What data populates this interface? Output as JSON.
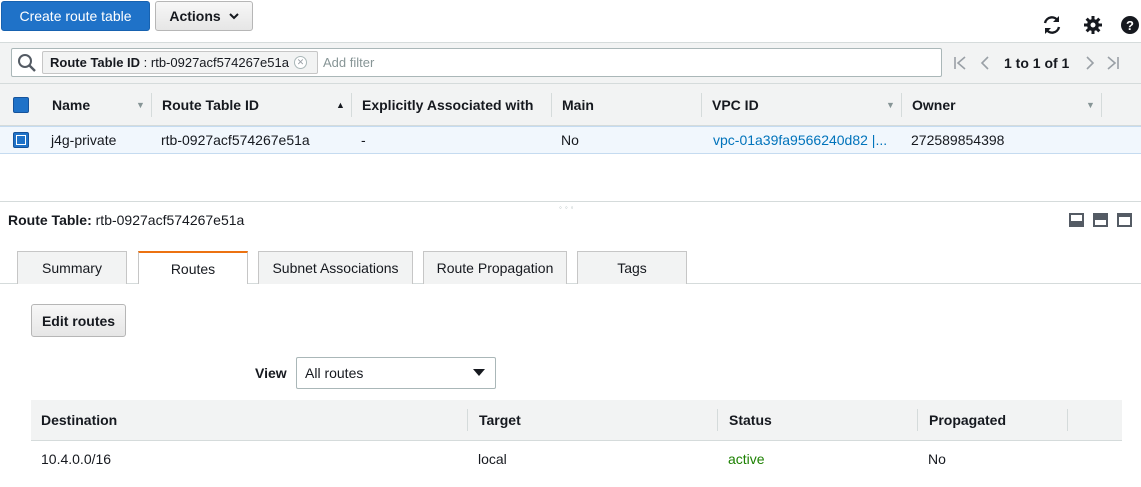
{
  "toolbar": {
    "create_label": "Create route table",
    "actions_label": "Actions",
    "icons": [
      "refresh-icon",
      "gear-icon",
      "help-icon"
    ]
  },
  "filter": {
    "token_key": "Route Table ID",
    "token_separator": " : ",
    "token_value": "rtb-0927acf574267e51a",
    "placeholder": "Add filter"
  },
  "pagination": {
    "text": "1 to 1 of 1"
  },
  "route_tables": {
    "columns": [
      "Name",
      "Route Table ID",
      "Explicitly Associated with",
      "Main",
      "VPC ID",
      "Owner"
    ],
    "rows": [
      {
        "selected": true,
        "name": "j4g-private",
        "route_table_id": "rtb-0927acf574267e51a",
        "explicit_assoc": "-",
        "main": "No",
        "vpc_id": "vpc-01a39fa9566240d82 |...",
        "owner": "272589854398"
      }
    ]
  },
  "details": {
    "title_label": "Route Table:",
    "title_value": "rtb-0927acf574267e51a",
    "tabs": [
      {
        "label": "Summary",
        "active": false
      },
      {
        "label": "Routes",
        "active": true
      },
      {
        "label": "Subnet Associations",
        "active": false
      },
      {
        "label": "Route Propagation",
        "active": false
      },
      {
        "label": "Tags",
        "active": false
      }
    ],
    "edit_routes_label": "Edit routes",
    "view_label": "View",
    "view_selected": "All routes"
  },
  "routes": {
    "columns": [
      "Destination",
      "Target",
      "Status",
      "Propagated"
    ],
    "rows": [
      {
        "destination": "10.4.0.0/16",
        "target": "local",
        "status": "active",
        "propagated": "No"
      }
    ]
  },
  "colors": {
    "primary": "#1f72c8",
    "link": "#0073bb",
    "active_tab": "#ec7211",
    "status_active": "#1d8102"
  }
}
